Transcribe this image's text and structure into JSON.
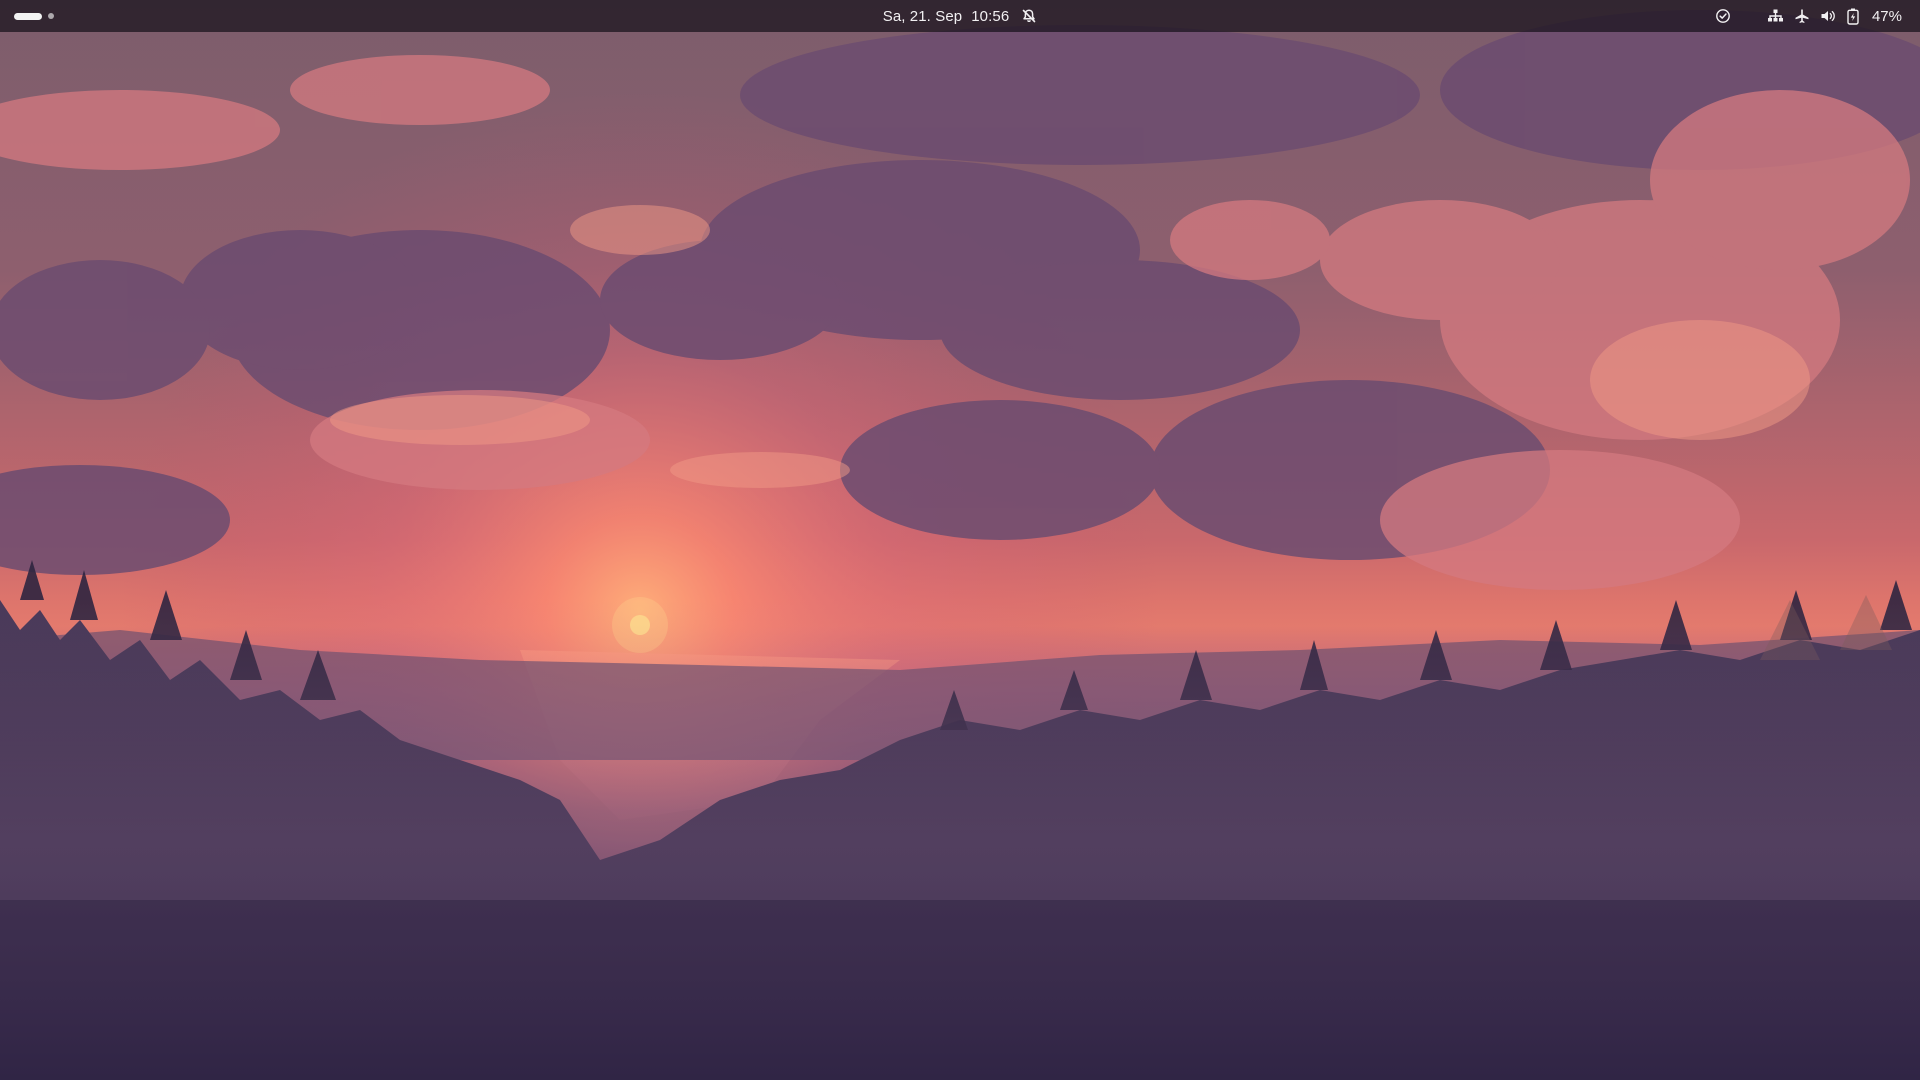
{
  "top_bar": {
    "clock": {
      "date": "Sa, 21. Sep",
      "time": "10:56"
    },
    "status": {
      "battery_percent": "47%"
    },
    "icons": {
      "notifications": "bell-off-icon",
      "background_app": "checkmark-circle-icon",
      "network": "wired-network-icon",
      "airplane": "airplane-icon",
      "volume": "volume-icon",
      "battery": "battery-charging-icon"
    }
  },
  "wallpaper": {
    "colors": {
      "sky_top": "#7a5a6e",
      "sunset_glow": "#f07a6e",
      "sun": "#ffd27a",
      "clouds": "#6a4a72",
      "clouds_lit": "#d47a7a",
      "forest": "#2e2440",
      "fog": "#8a6a8a"
    }
  }
}
